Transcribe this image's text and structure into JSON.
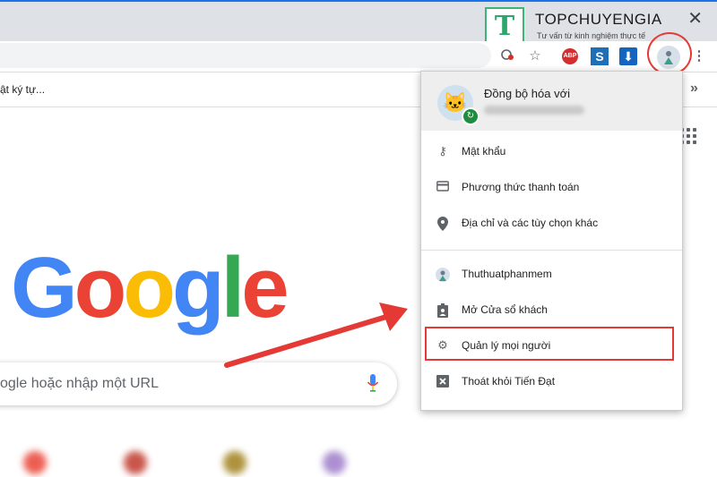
{
  "window": {
    "close_glyph": "✕"
  },
  "watermark": {
    "logo_letter": "T",
    "title": "TOPCHUYENGIA",
    "subtitle": "Tư vấn từ kinh nghiệm thực tế"
  },
  "toolbar": {
    "abp_label": "ABP",
    "s_label": "S",
    "icons": [
      "extension-icon",
      "star-icon",
      "abp-icon",
      "s-extension-icon",
      "download-icon",
      "profile-avatar-icon",
      "more-vert-icon"
    ]
  },
  "bookmarks": {
    "item_label": "ật ký tự...",
    "more_label": "»"
  },
  "google": {
    "logo_letters": [
      "G",
      "o",
      "o",
      "g",
      "l",
      "e"
    ],
    "logo_colors": [
      "#4285f4",
      "#ea4335",
      "#fbbc05",
      "#4285f4",
      "#34a853",
      "#ea4335"
    ],
    "search_placeholder": "ogle hoặc nhập một URL"
  },
  "profile_menu": {
    "sync_label": "Đồng bộ hóa với",
    "items_group1": [
      {
        "label": "Mật khẩu",
        "icon": "key-icon"
      },
      {
        "label": "Phương thức thanh toán",
        "icon": "credit-card-icon"
      },
      {
        "label": "Địa chỉ và các tùy chọn khác",
        "icon": "location-pin-icon"
      }
    ],
    "items_group2": [
      {
        "label": "Thuthuatphanmem",
        "icon": "profile-avatar-icon"
      },
      {
        "label": "Mở Cửa sổ khách",
        "icon": "guest-badge-icon"
      },
      {
        "label": "Quản lý mọi người",
        "icon": "gear-icon",
        "highlighted": true
      },
      {
        "label": "Thoát khỏi Tiến Đạt",
        "icon": "exit-icon"
      }
    ]
  },
  "colors": {
    "annotation_red": "#e53935",
    "accent_blue": "#1a73e8",
    "sync_green": "#1e8e3e"
  }
}
